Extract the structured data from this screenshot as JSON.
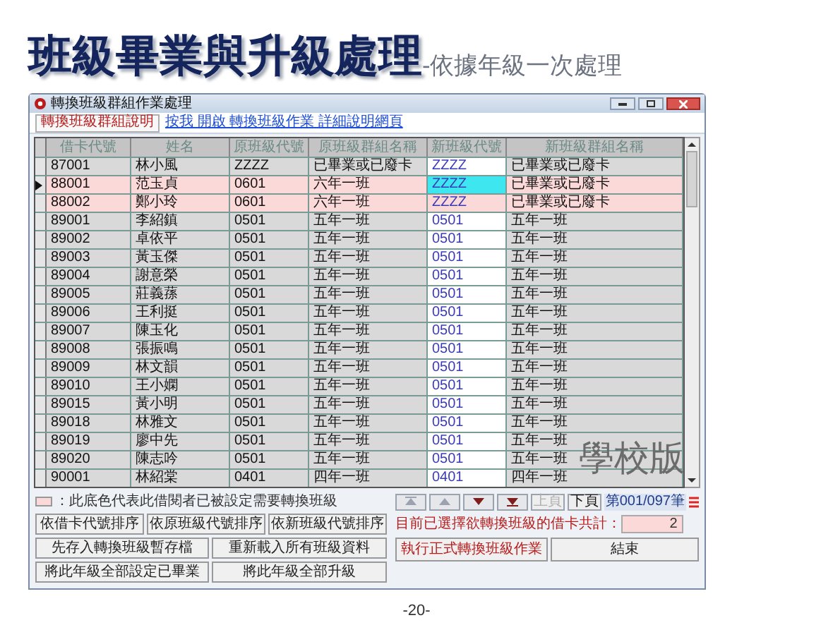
{
  "slide": {
    "title": "班級畢業與升級處理",
    "subtitle": "-依據年級一次處理",
    "overlay_text": "學校版",
    "page_number": "-20-"
  },
  "window": {
    "title": "轉換班級群組作業處理"
  },
  "toolbar": {
    "tab": "轉換班級群組說明",
    "link": "按我 開啟 轉換班級作業 詳細說明網頁"
  },
  "table": {
    "columns": [
      "借卡代號",
      "姓名",
      "原班級代號",
      "原班級群組名稱",
      "新班級代號",
      "新班級群組名稱"
    ],
    "rows": [
      {
        "cells": [
          "87001",
          "林小風",
          "ZZZZ",
          "已畢業或已廢卡",
          "ZZZZ",
          "已畢業或已廢卡"
        ],
        "marked": false,
        "selected": false
      },
      {
        "cells": [
          "88001",
          "范玉貞",
          "0601",
          "六年一班",
          "ZZZZ",
          "已畢業或已廢卡"
        ],
        "marked": true,
        "selected": true
      },
      {
        "cells": [
          "88002",
          "鄭小玲",
          "0601",
          "六年一班",
          "ZZZZ",
          "已畢業或已廢卡"
        ],
        "marked": true,
        "selected": false
      },
      {
        "cells": [
          "89001",
          "李紹鎮",
          "0501",
          "五年一班",
          "0501",
          "五年一班"
        ],
        "marked": false,
        "selected": false
      },
      {
        "cells": [
          "89002",
          "卓依平",
          "0501",
          "五年一班",
          "0501",
          "五年一班"
        ],
        "marked": false,
        "selected": false
      },
      {
        "cells": [
          "89003",
          "黃玉傑",
          "0501",
          "五年一班",
          "0501",
          "五年一班"
        ],
        "marked": false,
        "selected": false
      },
      {
        "cells": [
          "89004",
          "謝意榮",
          "0501",
          "五年一班",
          "0501",
          "五年一班"
        ],
        "marked": false,
        "selected": false
      },
      {
        "cells": [
          "89005",
          "莊義蓀",
          "0501",
          "五年一班",
          "0501",
          "五年一班"
        ],
        "marked": false,
        "selected": false
      },
      {
        "cells": [
          "89006",
          "王利挺",
          "0501",
          "五年一班",
          "0501",
          "五年一班"
        ],
        "marked": false,
        "selected": false
      },
      {
        "cells": [
          "89007",
          "陳玉化",
          "0501",
          "五年一班",
          "0501",
          "五年一班"
        ],
        "marked": false,
        "selected": false
      },
      {
        "cells": [
          "89008",
          "張振鳴",
          "0501",
          "五年一班",
          "0501",
          "五年一班"
        ],
        "marked": false,
        "selected": false
      },
      {
        "cells": [
          "89009",
          "林文韻",
          "0501",
          "五年一班",
          "0501",
          "五年一班"
        ],
        "marked": false,
        "selected": false
      },
      {
        "cells": [
          "89010",
          "王小嫻",
          "0501",
          "五年一班",
          "0501",
          "五年一班"
        ],
        "marked": false,
        "selected": false
      },
      {
        "cells": [
          "89015",
          "黃小明",
          "0501",
          "五年一班",
          "0501",
          "五年一班"
        ],
        "marked": false,
        "selected": false
      },
      {
        "cells": [
          "89018",
          "林雅文",
          "0501",
          "五年一班",
          "0501",
          "五年一班"
        ],
        "marked": false,
        "selected": false
      },
      {
        "cells": [
          "89019",
          "廖中先",
          "0501",
          "五年一班",
          "0501",
          "五年一班"
        ],
        "marked": false,
        "selected": false
      },
      {
        "cells": [
          "89020",
          "陳志吟",
          "0501",
          "五年一班",
          "0501",
          "五年一班"
        ],
        "marked": false,
        "selected": false
      },
      {
        "cells": [
          "90001",
          "林紹棠",
          "0401",
          "四年一班",
          "0401",
          "四年一班"
        ],
        "marked": false,
        "selected": false
      }
    ]
  },
  "legend": "：此底色代表此借閱者已被設定需要轉換班級",
  "nav": {
    "arrows": [
      {
        "kind": "first",
        "disabled": true
      },
      {
        "kind": "prev",
        "disabled": true
      },
      {
        "kind": "next",
        "disabled": false
      },
      {
        "kind": "last",
        "disabled": false
      }
    ],
    "pages": [
      {
        "label": "上頁",
        "disabled": true
      },
      {
        "label": "下頁",
        "disabled": false
      }
    ],
    "record": "第001/097筆"
  },
  "selected_count": {
    "label": "目前已選擇欲轉換班級的借卡共計：",
    "value": "2"
  },
  "left_buttons": [
    [
      "依借卡代號排序",
      "依原班級代號排序",
      "依新班級代號排序"
    ],
    [
      "先存入轉換班級暫存檔",
      "重新載入所有班級資料"
    ],
    [
      "將此年級全部設定已畢業",
      "將此年級全部升級"
    ]
  ],
  "right_buttons": [
    "執行正式轉換班級作業",
    "結束"
  ]
}
